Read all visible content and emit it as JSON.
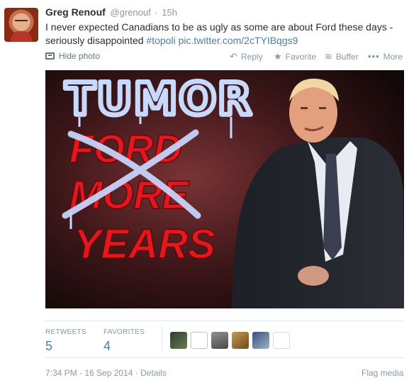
{
  "tweet": {
    "fullname": "Greg Renouf",
    "username": "@grenouf",
    "separator": "·",
    "time": "15h",
    "text_before": "I never expected Canadians to be as ugly as some are about Ford these days - seriously disappointed ",
    "hashtag": "#topoli",
    "link": "pic.twitter.com/2cTYIBqgs9"
  },
  "actions": {
    "hide_photo": "Hide photo",
    "reply": "Reply",
    "favorite": "Favorite",
    "buffer": "Buffer",
    "more": "More"
  },
  "media": {
    "graffiti": "TUMOR",
    "line1": "FORD",
    "line2": "MORE",
    "line3": "YEARS"
  },
  "stats": {
    "retweets_label": "RETWEETS",
    "retweets_count": "5",
    "favorites_label": "FAVORITES",
    "favorites_count": "4"
  },
  "footer": {
    "timestamp": "7:34 PM - 16 Sep 2014",
    "separator": "·",
    "details": "Details",
    "flag": "Flag media"
  },
  "colors": {
    "link": "#4d7fa0",
    "muted": "#8899a6",
    "poster_red": "#e3171d",
    "graffiti_blue": "#c8d9ff"
  },
  "icons": [
    "photo-icon",
    "reply-icon",
    "star-icon",
    "buffer-icon",
    "more-icon"
  ]
}
